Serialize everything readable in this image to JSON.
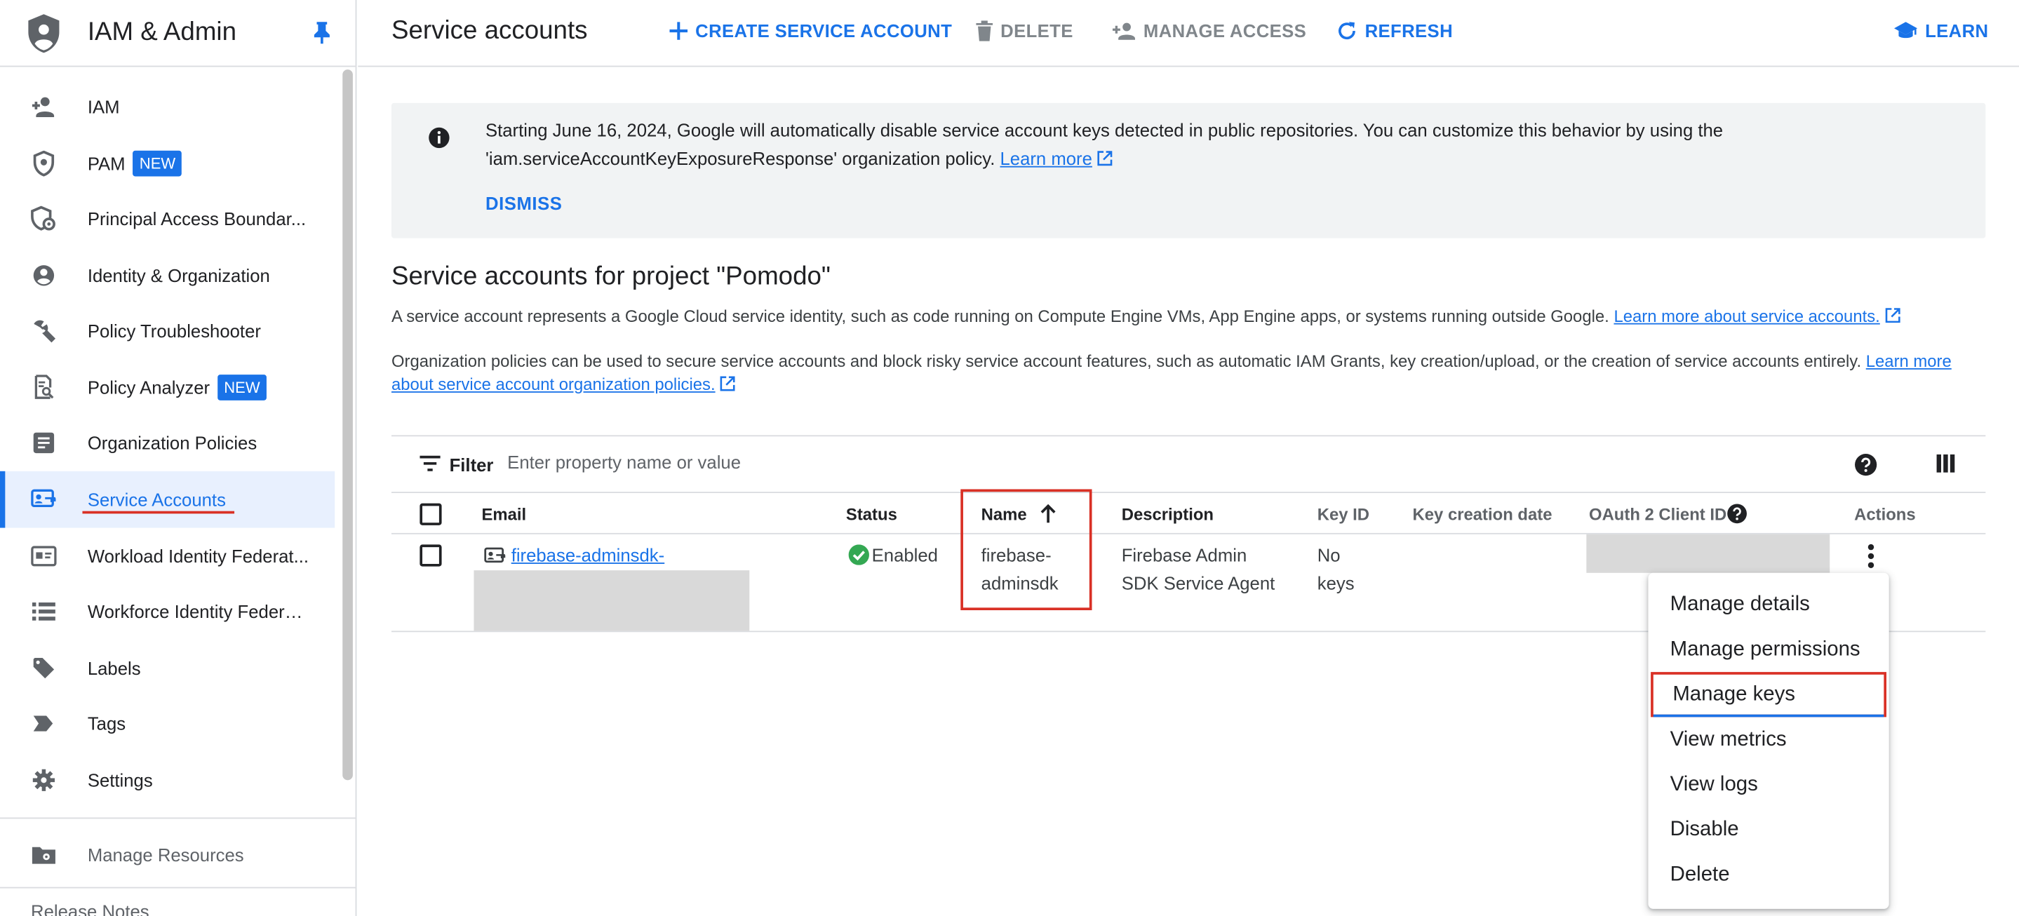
{
  "app": {
    "title": "IAM & Admin"
  },
  "sidebar": {
    "items": [
      {
        "label": "IAM",
        "icon": "person-add-icon"
      },
      {
        "label": "PAM",
        "icon": "shield-icon",
        "badge": "NEW"
      },
      {
        "label": "Principal Access Boundar...",
        "icon": "shield-settings-icon"
      },
      {
        "label": "Identity & Organization",
        "icon": "account-circle-icon"
      },
      {
        "label": "Policy Troubleshooter",
        "icon": "wrench-icon"
      },
      {
        "label": "Policy Analyzer",
        "icon": "document-search-icon",
        "badge": "NEW"
      },
      {
        "label": "Organization Policies",
        "icon": "policy-doc-icon"
      },
      {
        "label": "Service Accounts",
        "icon": "service-account-icon",
        "active": true
      },
      {
        "label": "Workload Identity Federat...",
        "icon": "id-card-icon"
      },
      {
        "label": "Workforce Identity Federa...",
        "icon": "list-icon"
      },
      {
        "label": "Labels",
        "icon": "tag-icon"
      },
      {
        "label": "Tags",
        "icon": "label-arrow-icon"
      },
      {
        "label": "Settings",
        "icon": "gear-icon"
      }
    ],
    "manage_resources": "Manage Resources",
    "cut_item": "Release Notes"
  },
  "toolbar": {
    "page_title": "Service accounts",
    "create": "CREATE SERVICE ACCOUNT",
    "delete": "DELETE",
    "manage_access": "MANAGE ACCESS",
    "refresh": "REFRESH",
    "learn": "LEARN"
  },
  "banner": {
    "text_line1": "Starting June 16, 2024, Google will automatically disable service account keys detected in public repositories. You can customize this behavior by using the",
    "text_line2": "'iam.serviceAccountKeyExposureResponse' organization policy.",
    "learn_more": "Learn more",
    "dismiss": "DISMISS"
  },
  "section": {
    "title": "Service accounts for project \"Pomodo\"",
    "desc1": "A service account represents a Google Cloud service identity, such as code running on Compute Engine VMs, App Engine apps, or systems running outside Google.",
    "desc1_link": "Learn more about service accounts.",
    "desc2": "Organization policies can be used to secure service accounts and block risky service account features, such as automatic IAM Grants, key creation/upload, or the creation of service accounts entirely.",
    "desc2_link_a": "Learn more",
    "desc2_link_b": "about service account organization policies."
  },
  "filter": {
    "label": "Filter",
    "placeholder": "Enter property name or value"
  },
  "table": {
    "columns": {
      "email": "Email",
      "status": "Status",
      "name": "Name",
      "description": "Description",
      "key_id": "Key ID",
      "key_date": "Key creation date",
      "oauth": "OAuth 2 Client ID",
      "actions": "Actions"
    },
    "sort": {
      "column": "Name",
      "direction": "ascending"
    },
    "rows": [
      {
        "email": "firebase-adminsdk-",
        "status": "Enabled",
        "name_line1": "firebase-",
        "name_line2": "adminsdk",
        "desc_line1": "Firebase Admin",
        "desc_line2": "SDK Service Agent",
        "keys_line1": "No",
        "keys_line2": "keys"
      }
    ]
  },
  "menu": {
    "items": [
      "Manage details",
      "Manage permissions",
      "Manage keys",
      "View metrics",
      "View logs",
      "Disable",
      "Delete"
    ],
    "highlighted": "Manage keys"
  },
  "colors": {
    "accent": "#1a73e8",
    "highlight_border": "#d93025",
    "success": "#34a853"
  }
}
